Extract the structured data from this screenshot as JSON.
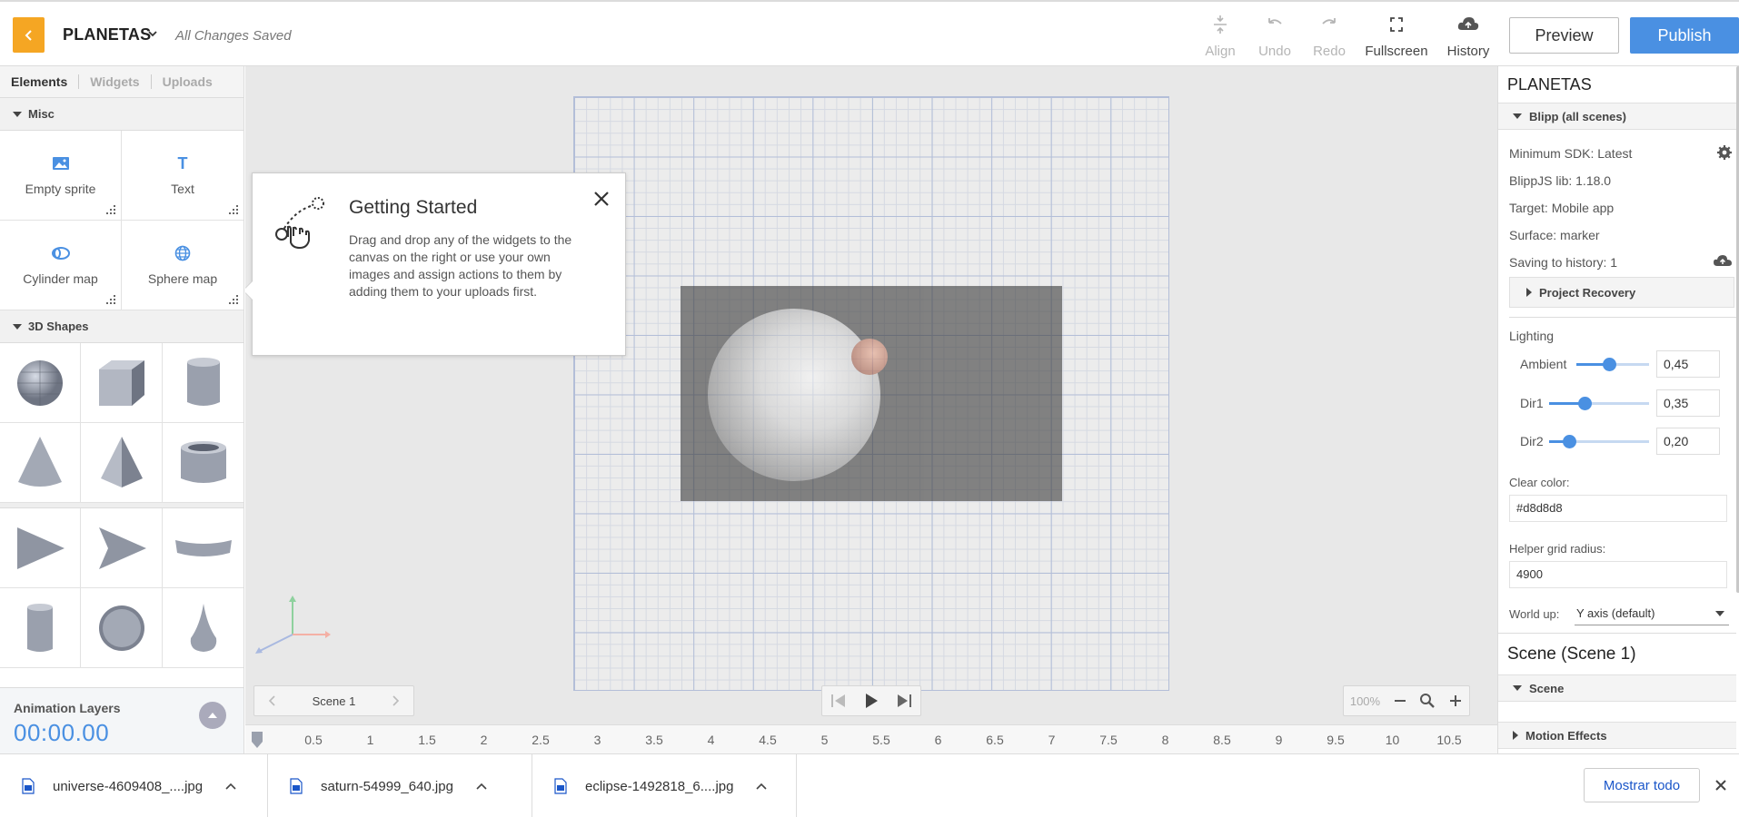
{
  "header": {
    "project_title": "PLANETAS",
    "save_status": "All Changes Saved",
    "tools": [
      {
        "label": "Align",
        "icon": "align-icon",
        "enabled": false
      },
      {
        "label": "Undo",
        "icon": "undo-icon",
        "enabled": false
      },
      {
        "label": "Redo",
        "icon": "redo-icon",
        "enabled": false
      },
      {
        "label": "Fullscreen",
        "icon": "fullscreen-icon",
        "enabled": true
      },
      {
        "label": "History",
        "icon": "cloud-history-icon",
        "enabled": true
      }
    ],
    "preview_label": "Preview",
    "publish_label": "Publish",
    "accent_color": "#f5a623",
    "publish_color": "#4a90e2"
  },
  "left_panel": {
    "tabs": [
      "Elements",
      "Widgets",
      "Uploads"
    ],
    "active_tab": "Elements",
    "misc_title": "Misc",
    "misc_items": [
      {
        "label": "Empty sprite",
        "icon": "image-icon"
      },
      {
        "label": "Text",
        "icon": "text-icon"
      },
      {
        "label": "Cylinder map",
        "icon": "cylinder-map-icon"
      },
      {
        "label": "Sphere map",
        "icon": "globe-icon"
      }
    ],
    "shapes_title": "3D Shapes",
    "shapes": [
      "sphere",
      "cube",
      "cylinder",
      "cone",
      "pyramid",
      "tube",
      "triangle",
      "arrow",
      "curved-plane",
      "can",
      "disc",
      "drop"
    ]
  },
  "animation": {
    "title": "Animation Layers",
    "time": "00:00.00"
  },
  "popup": {
    "title": "Getting Started",
    "text": "Drag and drop any of the widgets to the canvas on the right or use your own images and assign actions to them by adding them to your uploads first."
  },
  "canvas": {
    "scene_label": "Scene 1",
    "zoom_label": "100%",
    "background": "#e8e8e8",
    "grid_color": "#b3bed8"
  },
  "timeline": {
    "ticks": [
      "0.5",
      "1",
      "1.5",
      "2",
      "2.5",
      "3",
      "3.5",
      "4",
      "4.5",
      "5",
      "5.5",
      "6",
      "6.5",
      "7",
      "7.5",
      "8",
      "8.5",
      "9",
      "9.5",
      "10",
      "10.5"
    ]
  },
  "right_panel": {
    "title": "PLANETAS",
    "blipp_section": "Blipp (all scenes)",
    "min_sdk": "Minimum SDK: Latest",
    "blippjs_lib": "BlippJS lib: 1.18.0",
    "target": "Target: Mobile app",
    "surface": "Surface: marker",
    "saving_history": "Saving to history: 1",
    "project_recovery": "Project Recovery",
    "lighting_label": "Lighting",
    "sliders": [
      {
        "label": "Ambient",
        "value": "0,45",
        "fraction": 0.45
      },
      {
        "label": "Dir1",
        "value": "0,35",
        "fraction": 0.35
      },
      {
        "label": "Dir2",
        "value": "0,20",
        "fraction": 0.2
      }
    ],
    "clear_color_label": "Clear color:",
    "clear_color_value": "#d8d8d8",
    "helper_grid_label": "Helper grid radius:",
    "helper_grid_value": "4900",
    "world_up_label": "World up:",
    "world_up_value": "Y axis (default)",
    "scene_title": "Scene (Scene 1)",
    "scene_section": "Scene",
    "motion_section": "Motion Effects"
  },
  "downloads": {
    "files": [
      "universe-4609408_....jpg",
      "saturn-54999_640.jpg",
      "eclipse-1492818_6....jpg"
    ],
    "show_all_label": "Mostrar todo"
  }
}
